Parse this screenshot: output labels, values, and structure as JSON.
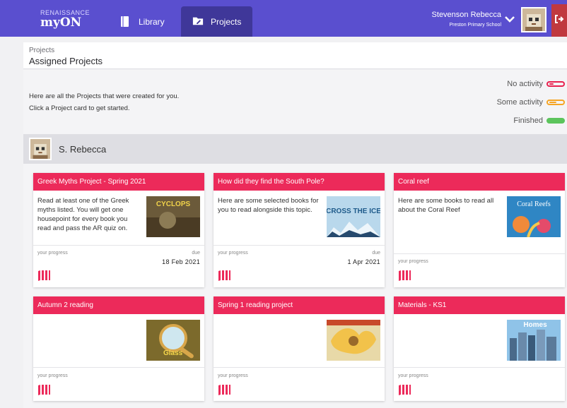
{
  "nav": {
    "brand": "RENAISSANCE",
    "product": "myON",
    "library_label": "Library",
    "projects_label": "Projects"
  },
  "user": {
    "name": "Stevenson Rebecca",
    "school": "Preston Primary School"
  },
  "breadcrumb": {
    "parent": "Projects",
    "title": "Assigned Projects"
  },
  "intro": {
    "line1": "Here are all the Projects that were created for you.",
    "line2": "Click a Project card to get started."
  },
  "legend": {
    "none": "No activity",
    "some": "Some activity",
    "done": "Finished"
  },
  "student": {
    "name": "S. Rebecca"
  },
  "colors": {
    "nav_bg": "#5a4fcf",
    "nav_active": "#3f3799",
    "card_header": "#ec2a5a",
    "logout": "#c0393f"
  },
  "cards": [
    {
      "title": "Greek Myths Project - Spring 2021",
      "description": "Read at least one of the Greek myths listed. You will get one housepoint for every book you read and pass the AR quiz on.",
      "progress_label": "your progress",
      "due_label": "due",
      "due_date": "18 Feb 2021",
      "cover_text": "CYCLOPS"
    },
    {
      "title": "How did they find the South Pole?",
      "description": "Here are some selected books for you to read alongside this topic.",
      "progress_label": "your progress",
      "due_label": "due",
      "due_date": "1 Apr 2021",
      "cover_text": "CROSS THE ICE"
    },
    {
      "title": "Coral reef",
      "description": "Here are some books to read all about the Coral Reef",
      "progress_label": "your progress",
      "cover_text": "Coral Reefs"
    },
    {
      "title": "Autumn 2 reading",
      "description": "",
      "progress_label": "your progress",
      "cover_text": "Glass"
    },
    {
      "title": "Spring 1 reading project",
      "description": "",
      "progress_label": "your progress",
      "cover_text": ""
    },
    {
      "title": "Materials - KS1",
      "description": "",
      "progress_label": "your progress",
      "cover_text": "Homes"
    }
  ]
}
